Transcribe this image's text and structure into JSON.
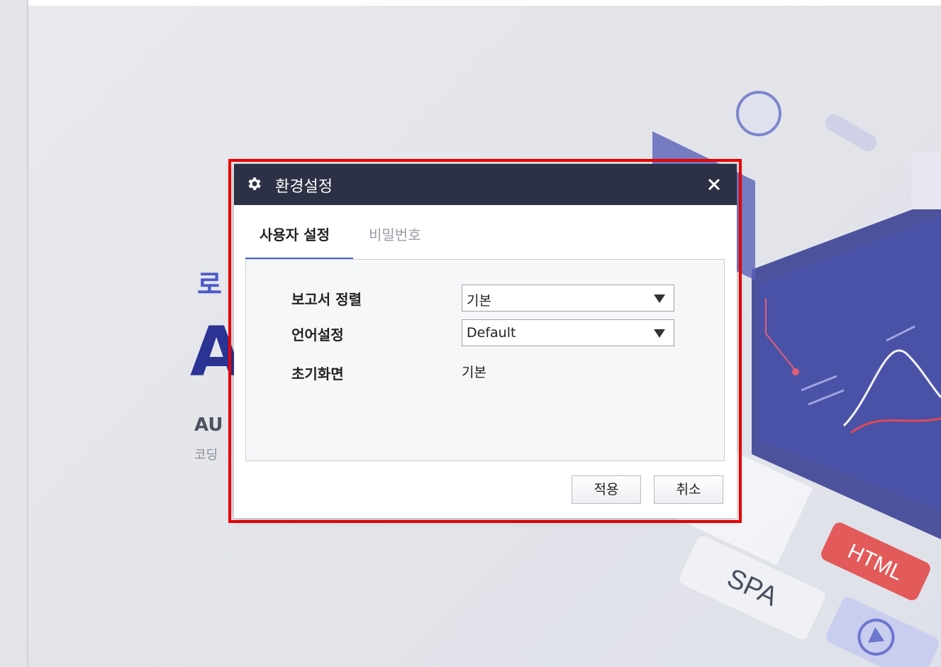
{
  "background": {
    "hero_small_text": "로",
    "hero_big_text": "A",
    "hero_sub_text": "AU",
    "hero_caption_text": "코딩",
    "badge_html": "HTML",
    "badge_spa": "SPA"
  },
  "dialog": {
    "title": "환경설정",
    "icon": "gear-icon",
    "close_icon": "close-icon",
    "tabs": [
      {
        "label": "사용자 설정",
        "active": true
      },
      {
        "label": "비밀번호",
        "active": false
      }
    ],
    "settings": {
      "report_sort": {
        "label": "보고서 정렬",
        "value": "기본"
      },
      "language": {
        "label": "언어설정",
        "value": "Default"
      },
      "start_screen": {
        "label": "초기화면",
        "value": "기본"
      }
    },
    "buttons": {
      "apply": "적용",
      "cancel": "취소"
    }
  },
  "colors": {
    "title_bar": "#2d3146",
    "active_tab_underline": "#4a5fd6",
    "highlight_border": "#ee0000"
  }
}
